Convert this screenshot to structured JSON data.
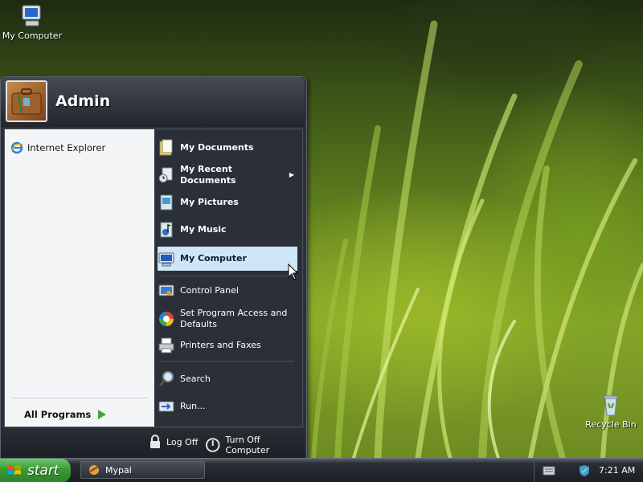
{
  "desktop": {
    "icons": [
      {
        "label": "My Computer",
        "icon": "my-computer-icon"
      },
      {
        "label": "Recycle Bin",
        "icon": "recycle-bin-icon"
      }
    ]
  },
  "start_menu": {
    "user_name": "Admin",
    "pinned": [
      {
        "label": "Internet Explorer",
        "icon": "internet-explorer-icon"
      }
    ],
    "all_programs_label": "All Programs",
    "right_items": [
      {
        "label": "My Documents",
        "icon": "my-documents-icon"
      },
      {
        "label": "My Recent Documents",
        "icon": "recent-documents-icon"
      },
      {
        "label": "My Pictures",
        "icon": "my-pictures-icon"
      },
      {
        "label": "My Music",
        "icon": "my-music-icon"
      },
      {
        "label": "My Computer",
        "icon": "my-computer-icon"
      },
      {
        "label": "Control Panel",
        "icon": "control-panel-icon"
      },
      {
        "label": "Set Program Access and Defaults",
        "icon": "program-access-icon"
      },
      {
        "label": "Printers and Faxes",
        "icon": "printer-icon"
      },
      {
        "label": "Search",
        "icon": "search-icon"
      },
      {
        "label": "Run...",
        "icon": "run-icon"
      }
    ],
    "log_off_label": "Log Off",
    "turn_off_label": "Turn Off Computer"
  },
  "taskbar": {
    "start_label": "start",
    "task": {
      "label": "Mypal",
      "icon": "mypal-icon"
    },
    "clock": "7:21 AM"
  },
  "colors": {
    "hover_bg": "#cfe6f6",
    "menu_dark": "#2b2f37",
    "start_green": "#3a9a35"
  }
}
